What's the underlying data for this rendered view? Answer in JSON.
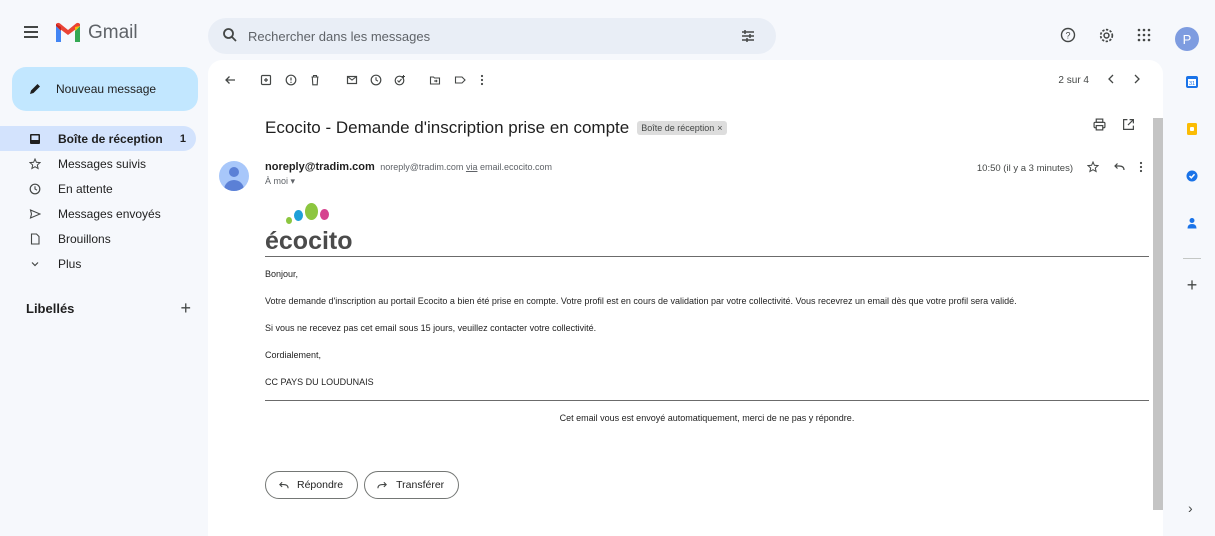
{
  "app": {
    "name": "Gmail"
  },
  "search": {
    "placeholder": "Rechercher dans les messages"
  },
  "account": {
    "initial": "P"
  },
  "compose": {
    "label": "Nouveau message"
  },
  "sidebar": {
    "items": [
      {
        "label": "Boîte de réception",
        "count": "1",
        "icon": "inbox-icon",
        "active": true
      },
      {
        "label": "Messages suivis",
        "icon": "star-icon"
      },
      {
        "label": "En attente",
        "icon": "clock-icon"
      },
      {
        "label": "Messages envoyés",
        "icon": "send-icon"
      },
      {
        "label": "Brouillons",
        "icon": "draft-icon"
      },
      {
        "label": "Plus",
        "icon": "chevron-down-icon"
      }
    ],
    "labels_header": "Libellés"
  },
  "pagination": {
    "text": "2 sur 4"
  },
  "email": {
    "subject": "Ecocito - Demande d'inscription prise en compte",
    "badge": "Boîte de réception",
    "sender_name": "noreply@tradim.com",
    "sender_email": "noreply@tradim.com",
    "via_label": "via",
    "via_domain": "email.ecocito.com",
    "to": "À moi",
    "time": "10:50 (il y a 3 minutes)",
    "logo_text": "écocito",
    "greeting": "Bonjour,",
    "paragraph1": "Votre demande d'inscription au portail Ecocito a bien été prise en compte. Votre profil est en cours de validation par votre collectivité. Vous recevrez un email dès que votre profil sera validé.",
    "paragraph2": "Si vous ne recevez pas cet email sous 15 jours, veuillez contacter votre collectivité.",
    "closing": "Cordialement,",
    "signature": "CC PAYS DU LOUDUNAIS",
    "footer": "Cet email vous est envoyé automatiquement, merci de ne pas y répondre."
  },
  "actions": {
    "reply": "Répondre",
    "forward": "Transférer"
  },
  "colors": {
    "accent": "#c2e7ff",
    "active_nav": "#d3e3fd",
    "background": "#f6f8fc",
    "logo_green": "#8cc63f",
    "logo_blue": "#1ea0d8",
    "logo_pink": "#d6438f"
  }
}
